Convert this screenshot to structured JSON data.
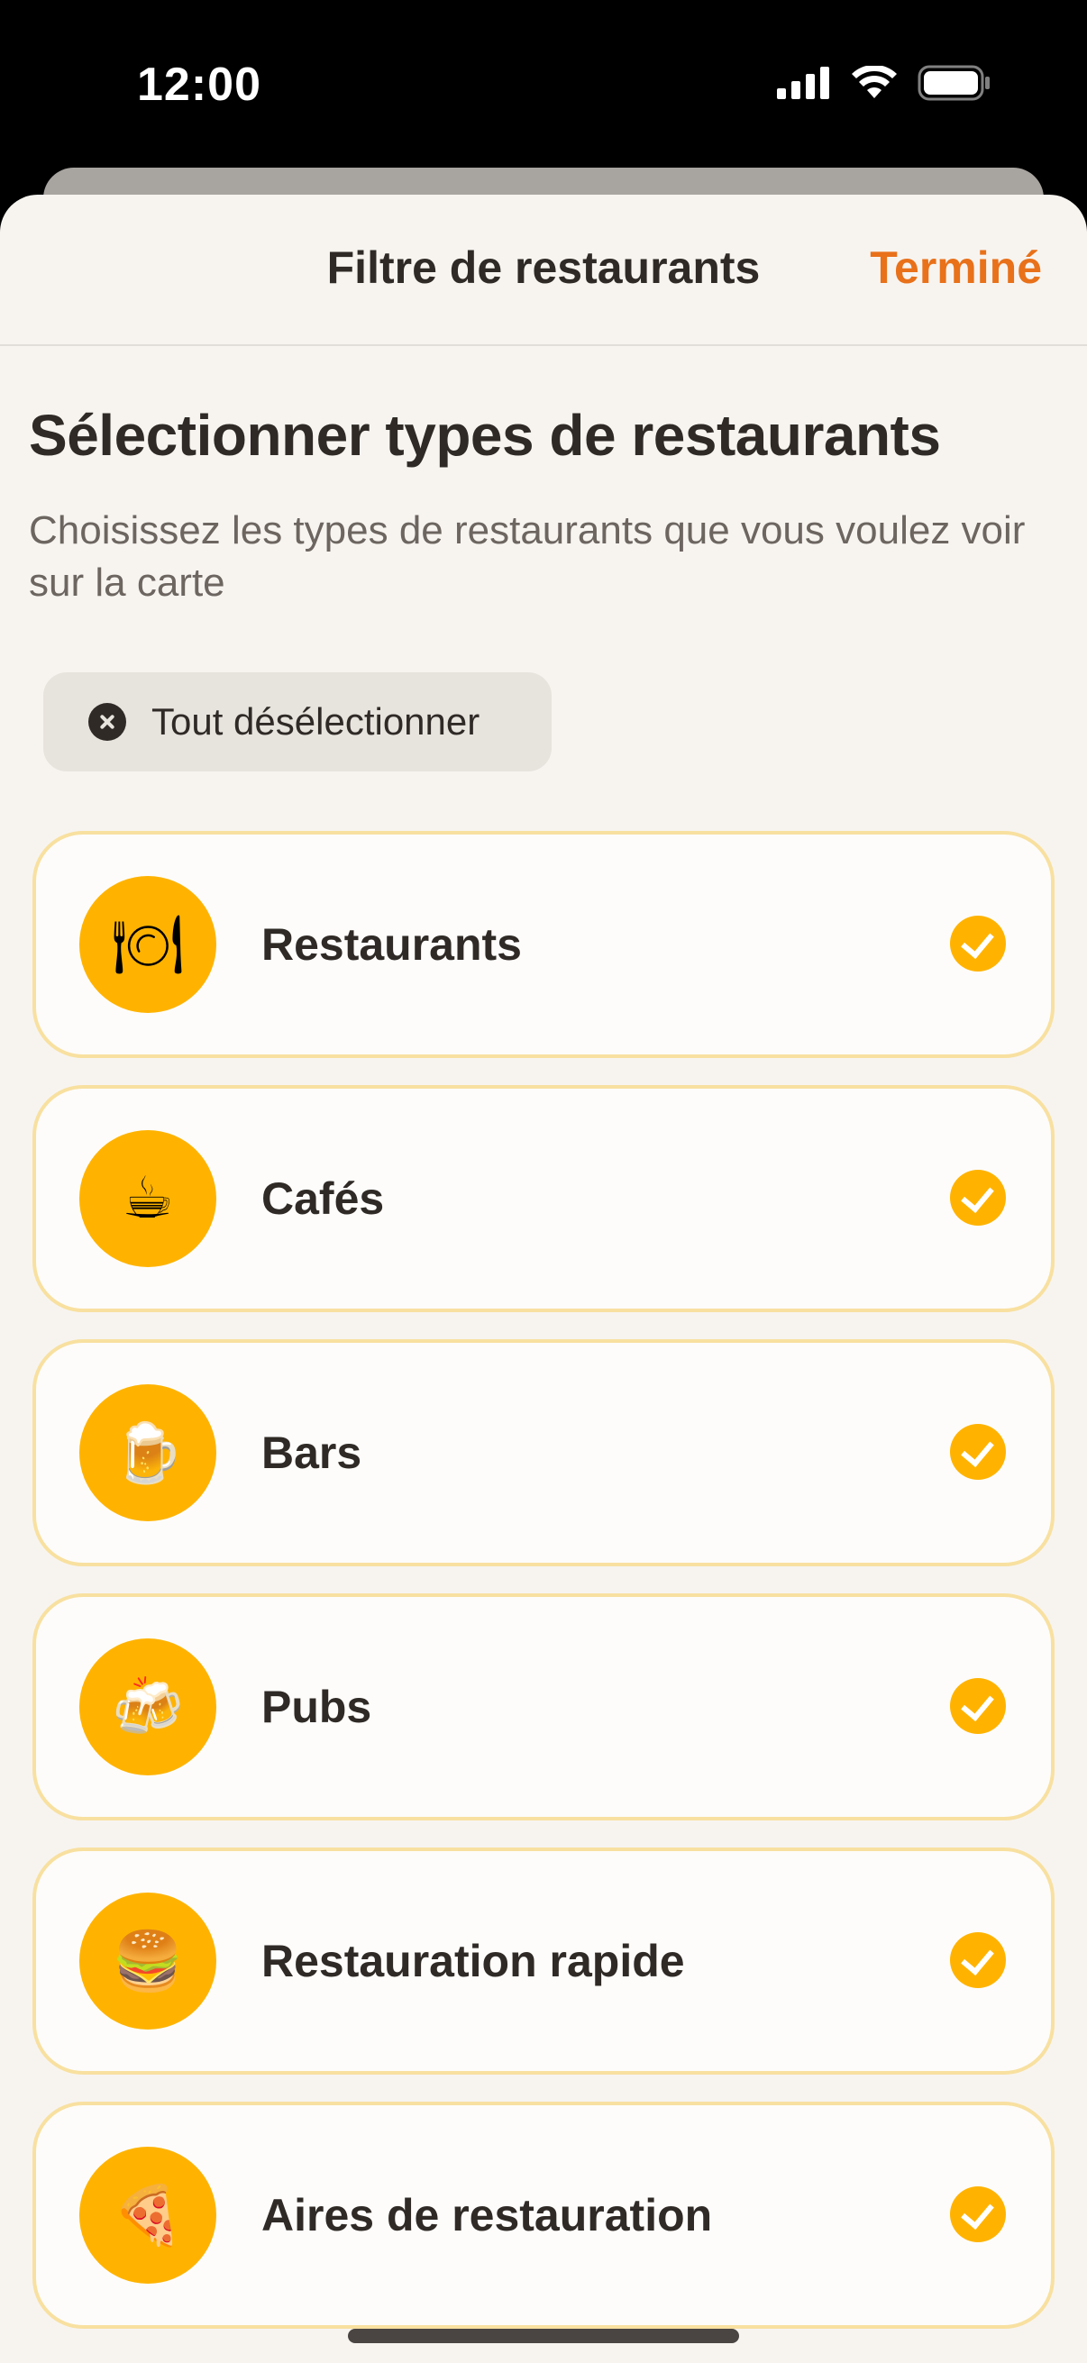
{
  "status_bar": {
    "time": "12:00"
  },
  "nav": {
    "title": "Filtre de restaurants",
    "done_label": "Terminé"
  },
  "page": {
    "heading": "Sélectionner types de restaurants",
    "subtitle": "Choisissez les types de restaurants que vous voulez voir sur la carte",
    "deselect_all_label": "Tout désélectionner"
  },
  "items": [
    {
      "label": "Restaurants",
      "icon": "plate-cutlery-icon",
      "emoji": "🍽",
      "selected": true
    },
    {
      "label": "Cafés",
      "icon": "coffee-cup-icon",
      "emoji": "☕",
      "selected": true
    },
    {
      "label": "Bars",
      "icon": "beer-mug-icon",
      "emoji": "🍺",
      "selected": true
    },
    {
      "label": "Pubs",
      "icon": "clinking-beer-icon",
      "emoji": "🍻",
      "selected": true
    },
    {
      "label": "Restauration rapide",
      "icon": "burger-icon",
      "emoji": "🍔",
      "selected": true
    },
    {
      "label": "Aires de restauration",
      "icon": "pizza-icon",
      "emoji": "🍕",
      "selected": true
    }
  ],
  "colors": {
    "accent_orange": "#e8711a",
    "amber": "#ffb300",
    "card_border": "#f8e0a0",
    "background": "#f7f4f0",
    "text_dark": "#2f2a26"
  }
}
